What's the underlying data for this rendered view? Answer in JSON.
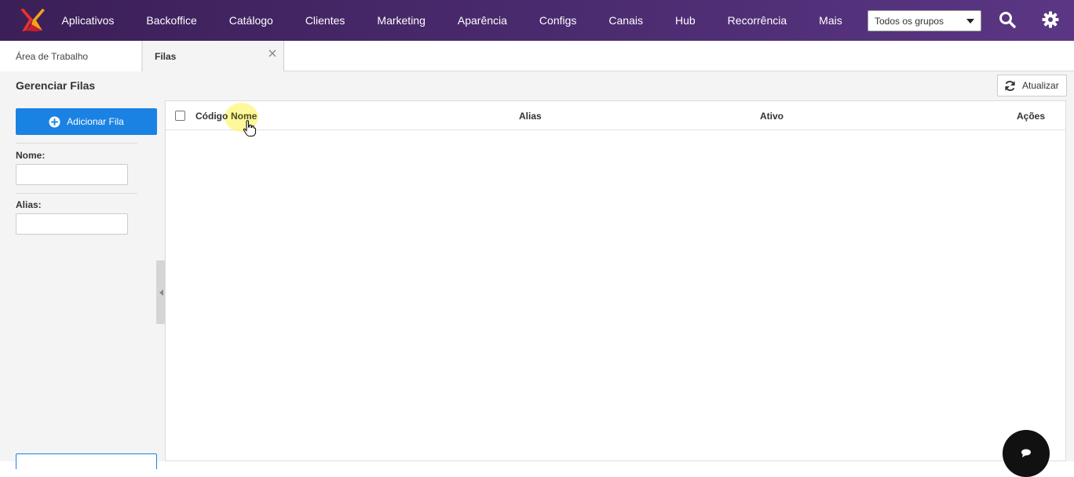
{
  "nav": {
    "items": [
      "Aplicativos",
      "Backoffice",
      "Catálogo",
      "Clientes",
      "Marketing",
      "Aparência",
      "Configs",
      "Canais",
      "Hub",
      "Recorrência",
      "Mais"
    ],
    "group_select": "Todos os grupos"
  },
  "tabs": [
    {
      "label": "Área de Trabalho"
    },
    {
      "label": "Filas"
    }
  ],
  "page": {
    "title": "Gerenciar Filas",
    "refresh_label": "Atualizar"
  },
  "sidebar": {
    "add_button": "Adicionar Fila",
    "fields": [
      {
        "label": "Nome:",
        "value": ""
      },
      {
        "label": "Alias:",
        "value": ""
      }
    ]
  },
  "grid": {
    "columns": [
      "Código",
      "Nome",
      "Alias",
      "Ativo",
      "Ações"
    ],
    "rows": []
  },
  "colors": {
    "topbar": "#4a2a6e",
    "primary": "#1a82e2",
    "logo_red": "#e8322b",
    "logo_orange": "#f6a21b"
  },
  "icons": [
    "logo-icon",
    "search-icon",
    "gear-icon",
    "close-icon",
    "refresh-icon",
    "plus-circle-icon",
    "chat-icon"
  ]
}
